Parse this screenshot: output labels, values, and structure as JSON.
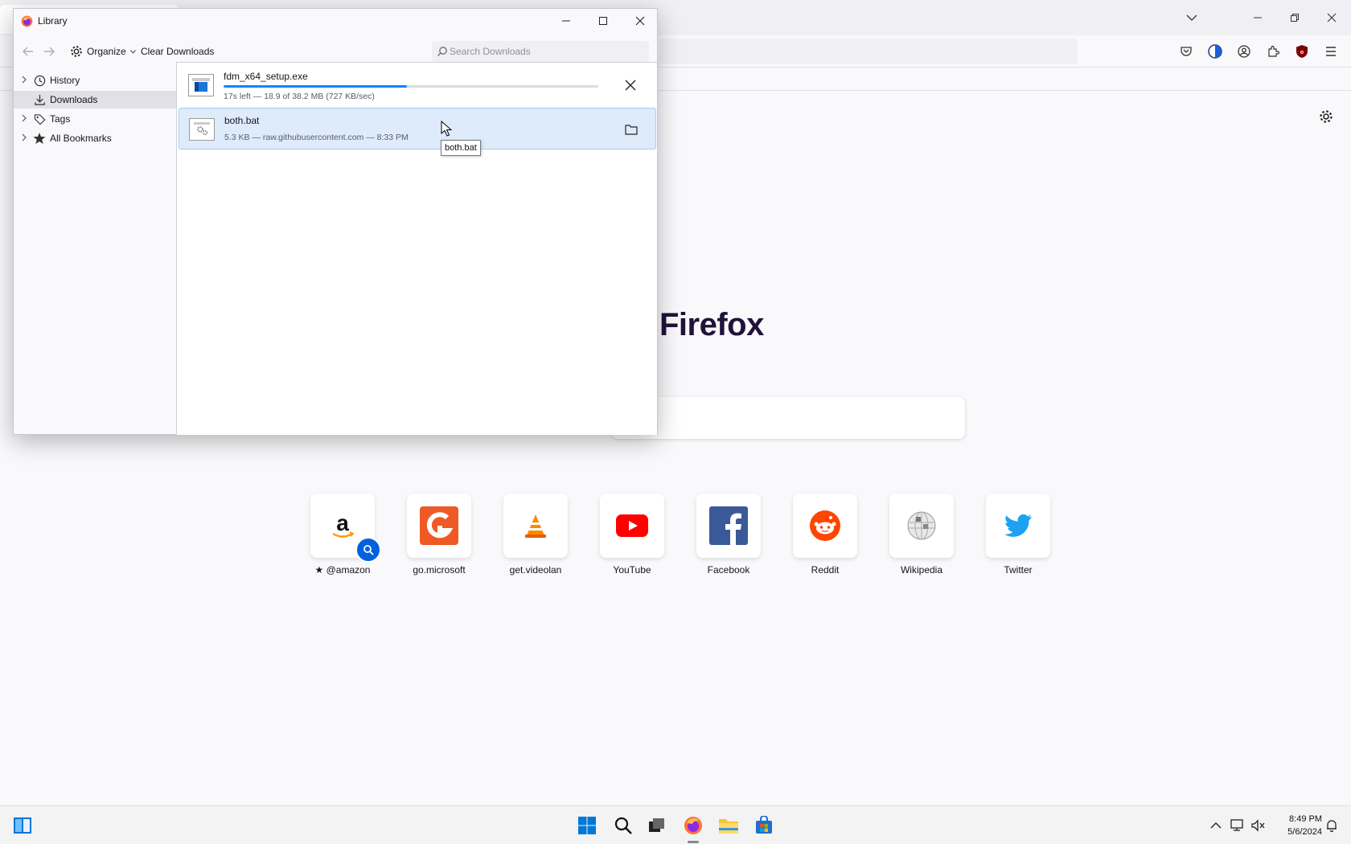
{
  "library": {
    "title": "Library",
    "toolbar": {
      "organize_label": "Organize",
      "clear_label": "Clear Downloads",
      "search_placeholder": "Search Downloads"
    },
    "sidebar": [
      {
        "label": "History",
        "icon": "clock-icon",
        "expandable": true
      },
      {
        "label": "Downloads",
        "icon": "download-icon",
        "expandable": false,
        "selected": true
      },
      {
        "label": "Tags",
        "icon": "tag-icon",
        "expandable": true
      },
      {
        "label": "All Bookmarks",
        "icon": "star-icon",
        "expandable": true
      }
    ],
    "downloads": [
      {
        "name": "fdm_x64_setup.exe",
        "status": "17s left — 18.9 of 38.2 MB (727 KB/sec)",
        "progress_percent": 49,
        "action": "cancel-icon"
      },
      {
        "name": "both.bat",
        "status": "5.3 KB — raw.githubusercontent.com — 8:33 PM",
        "action": "folder-icon"
      }
    ],
    "tooltip": "both.bat"
  },
  "browser": {
    "brand": "Firefox",
    "shortcuts": [
      {
        "label": "@amazon",
        "sponsored_icon": "pin-icon"
      },
      {
        "label": "go.microsoft"
      },
      {
        "label": "get.videolan"
      },
      {
        "label": "YouTube"
      },
      {
        "label": "Facebook"
      },
      {
        "label": "Reddit"
      },
      {
        "label": "Wikipedia"
      },
      {
        "label": "Twitter"
      }
    ]
  },
  "taskbar": {
    "time": "8:49 PM",
    "date": "5/6/2024"
  },
  "colors": {
    "accent": "#0a84ff",
    "selection": "#deebfb",
    "brand_text": "#20123a"
  }
}
